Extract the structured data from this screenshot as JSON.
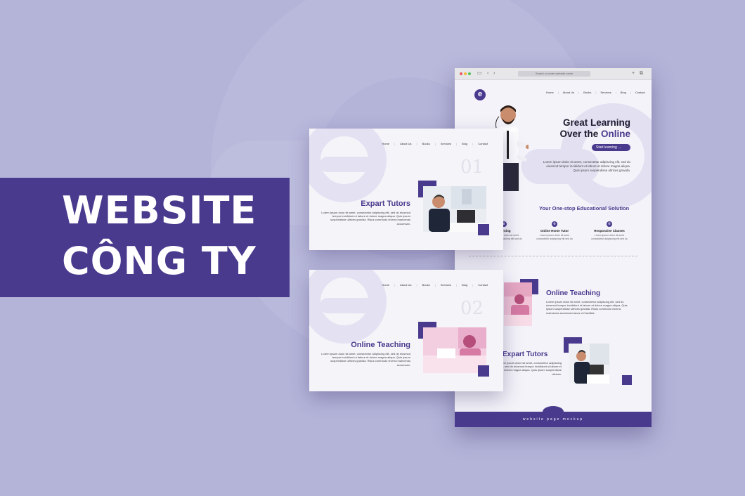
{
  "banner": {
    "line1": "WEBSITE",
    "line2": "CÔNG TY"
  },
  "browser": {
    "url": "Search or enter website name",
    "nav_back": "‹",
    "nav_fwd": "›",
    "plus": "+",
    "tabs": "⧉"
  },
  "site": {
    "logo_letter": "e",
    "nav": [
      "Home",
      "About Us",
      "Books",
      "Services",
      "Blog",
      "Contact"
    ],
    "nav_sep": "|",
    "hero_title_1": "Great Learning",
    "hero_title_2a": "Over the ",
    "hero_title_2b": "Online",
    "start_button": "Start learning →",
    "hero_body": "Lorem ipsum dolor sit amet, consectetur adipiscing elit, sed do eiusmod tempor incididunt ut labore et dolore magna aliqua. Quis ipsum suspendisse ultrices gravida.",
    "tagline": "Your One-stop Educational Solution",
    "features": [
      {
        "title": "Learning",
        "desc": "Lorem ipsum dolor sit amet consectetur adipiscing elit sed do"
      },
      {
        "title": "Online Home Tutor",
        "desc": "Lorem ipsum dolor sit amet consectetur adipiscing elit sed do"
      },
      {
        "title": "Responsive Classes",
        "desc": "Lorem ipsum dolor sit amet consectetur adipiscing elit sed do"
      }
    ],
    "section1_title": "Online Teaching",
    "section1_body": "Lorem ipsum dolor sit amet, consectetur adipiscing elit, sed do eiusmod tempor incididunt ut labore et dolore magna aliqua. Quis ipsum suspendisse ultrices gravida. Risus commodo viverra maecenas accumsan lacus vel facilisis.",
    "section2_title": "Expart Tutors",
    "section2_body": "Lorem ipsum dolor sit amet, consectetur adipiscing elit, sed do eiusmod tempor incididunt ut labore et dolore magna aliqua. Quis ipsum suspendisse ultrices.",
    "footer": "website page mockup"
  },
  "card1": {
    "number": "01",
    "title": "Expart Tutors",
    "body": "Lorem ipsum dolor sit amet, consectetur adipiscing elit, sed do eiusmod tempor incididunt ut labore et dolore magna aliqua. Quis ipsum suspendisse ultrices gravida. Risus commodo viverra maecenas accumsan."
  },
  "card2": {
    "number": "02",
    "title": "Online Teaching",
    "body": "Lorem ipsum dolor sit amet, consectetur adipiscing elit, sed do eiusmod tempor incididunt ut labore et dolore magna aliqua. Quis ipsum suspendisse ultrices gravida. Risus commodo viverra maecenas accumsan."
  },
  "colors": {
    "accent": "#4a3a8e",
    "background": "#b4b4d9",
    "light_accent": "#e3e0f2"
  }
}
